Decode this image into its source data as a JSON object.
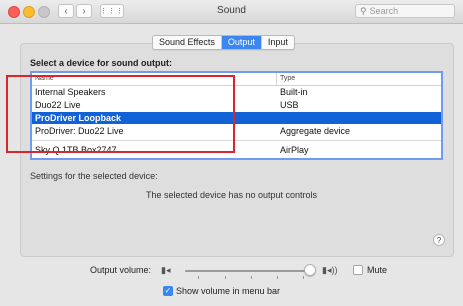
{
  "window": {
    "title": "Sound",
    "search_placeholder": "Search",
    "grid_icon": "grid-icon",
    "back_icon": "chevron-left-icon",
    "forward_icon": "chevron-right-icon"
  },
  "tabs": [
    {
      "label": "Sound Effects",
      "active": false
    },
    {
      "label": "Output",
      "active": true
    },
    {
      "label": "Input",
      "active": false
    }
  ],
  "output": {
    "heading": "Select a device for sound output:",
    "columns": {
      "name": "Name",
      "type": "Type"
    },
    "devices": [
      {
        "name": "Internal Speakers",
        "type": "Built-in",
        "selected": false
      },
      {
        "name": "Duo22 Live",
        "type": "USB",
        "selected": false
      },
      {
        "name": "ProDriver Loopback",
        "type": "",
        "selected": true
      },
      {
        "name": "ProDriver: Duo22 Live",
        "type": "Aggregate device",
        "selected": false
      },
      {
        "name": "Sky Q 1TB Box2747",
        "type": "AirPlay",
        "selected": false
      }
    ],
    "settings_label": "Settings for the selected device:",
    "no_controls_text": "The selected device has no output controls"
  },
  "volume": {
    "label": "Output volume:",
    "level": 0.96,
    "mute_label": "Mute",
    "mute_checked": false,
    "show_in_menu_label": "Show volume in menu bar",
    "show_in_menu_checked": true
  },
  "help_label": "?",
  "colors": {
    "accent": "#3b86f0",
    "selection": "#1162d6",
    "highlight_box": "#d8262b"
  }
}
